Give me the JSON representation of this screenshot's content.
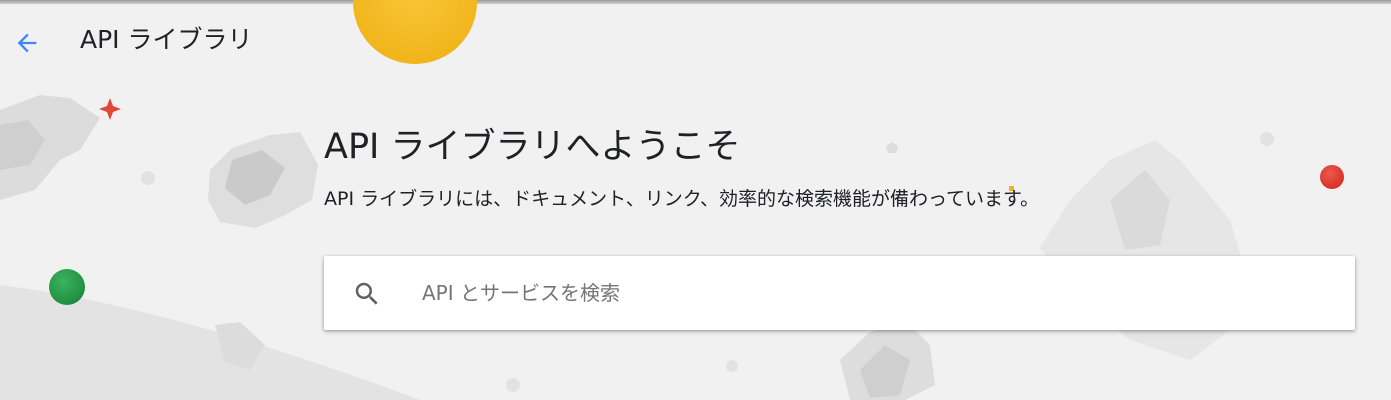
{
  "header": {
    "back_icon": "arrow-left-icon",
    "title": "API ライブラリ"
  },
  "welcome": {
    "title": "API ライブラリへようこそ",
    "subtitle": "API ライブラリには、ドキュメント、リンク、効率的な検索機能が備わっています。"
  },
  "search": {
    "icon": "search-icon",
    "placeholder": "API とサービスを検索",
    "value": ""
  },
  "colors": {
    "background": "#f1f1f1",
    "accent_blue": "#4285f4",
    "decor_yellow": "#f4b400",
    "decor_red": "#db4437",
    "decor_green": "#0f9d58"
  }
}
